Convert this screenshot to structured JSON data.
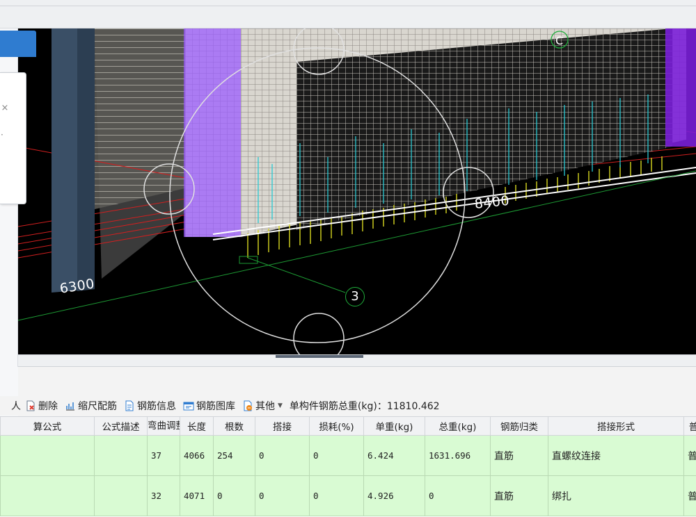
{
  "viewport": {
    "dimension_labels": [
      "8400",
      "6300"
    ],
    "axis_label": "3",
    "grid_letter": "C"
  },
  "toolbar": {
    "partial_left": "人",
    "delete_label": "删除",
    "scale_rebar_label": "缩尺配筋",
    "rebar_info_label": "钢筋信息",
    "rebar_library_label": "钢筋图库",
    "other_label": "其他",
    "total_weight_label": "单构件钢筋总重(kg)：11810.462"
  },
  "table": {
    "headers": [
      "算公式",
      "公式描述",
      "弯曲调整",
      "长度",
      "根数",
      "搭接",
      "损耗(%)",
      "单重(kg)",
      "总重(kg)",
      "钢筋归类",
      "搭接形式",
      "普"
    ],
    "rows": [
      [
        "",
        "",
        "37",
        "4066",
        "254",
        "0",
        "0",
        "6.424",
        "1631.696",
        "直筋",
        "直螺纹连接",
        "普"
      ],
      [
        "",
        "",
        "32",
        "4071",
        "0",
        "0",
        "0",
        "4.926",
        "0",
        "直筋",
        "绑扎",
        "普"
      ]
    ]
  },
  "colors": {
    "row_highlight": "#d9fbd3",
    "viewport_bg": "#000000",
    "purple_wall": "#9b5cff",
    "column_slate": "#3a4f66"
  },
  "icons": [
    "delete-icon",
    "scale-rebar-icon",
    "rebar-info-icon",
    "rebar-library-icon",
    "other-icon",
    "dialog-close-icon"
  ]
}
